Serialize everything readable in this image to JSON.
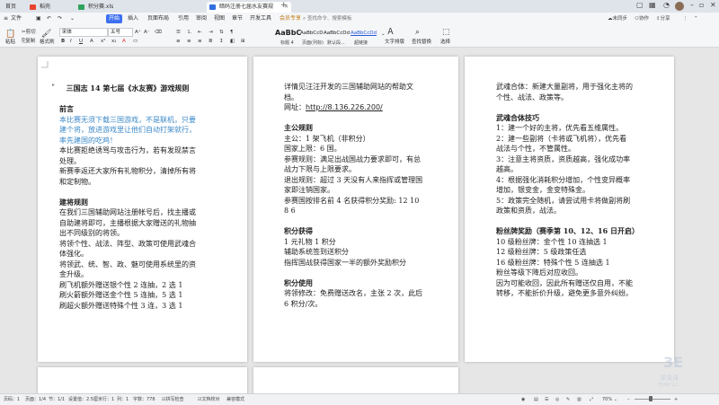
{
  "tabs": {
    "home": "首页",
    "t1": "稻壳",
    "t2": "积分赛.xls",
    "t3": "暗码注册七届水友赛规则1.0.docx"
  },
  "menu": [
    "文件",
    "开始",
    "插入",
    "页面布局",
    "引用",
    "审阅",
    "视图",
    "章节",
    "开发工具",
    "会员专享"
  ],
  "search_placeholder": "查找命令、搜索模板",
  "menu_right": {
    "unsync": "未同步",
    "cooperate": "协作",
    "share": "分享"
  },
  "ribbon": {
    "paste": "粘贴",
    "cut": "剪切",
    "copy": "复制",
    "format_painter": "格式刷",
    "font": "宋体",
    "font_size": "五号",
    "styles": [
      {
        "preview": "AaBbC",
        "label": "标题 4"
      },
      {
        "preview": "AaBbCcD",
        "label": "页面(列标)"
      },
      {
        "preview": "AaBbCcDd",
        "label": "默认段..."
      },
      {
        "preview": "AaBbCcDd",
        "label": "超链接"
      }
    ],
    "text_tools": "文字排版",
    "find_replace": "查找替换",
    "select": "选择"
  },
  "page1": {
    "title": "三国志 14 第七届《水友赛》游戏规则",
    "h_preface": "前言",
    "preface_blue": [
      "本比赛无须下载三国游戏，不是联机，只要",
      "建个将，放进游戏里让他们自动打架就行，",
      "率先建国的吃鸡！"
    ],
    "preface": [
      "本比赛拒绝诱骂与攻击行为，若有发现禁言",
      "处理。",
      "新赛季返还大家所有礼物积分，清掉所有将",
      "和定制物。"
    ],
    "h_rules": "建将规则",
    "rules": [
      "在我们三国辅助网站注册帐号后，找主播或",
      "自助建将即可，主播根据大家赠送的礼物抽",
      "出不同级别的将领。",
      "将领个性、战法、阵型、政策可使用武魂合",
      "体强化。",
      "将领武、统、智、政、魅可使用系统里的资",
      "金升级。",
      "刷飞机额外赠送银个性 2 连抽，2 选 1",
      "刷火箭额外赠送金个性 5 连抽，5 选 1",
      "刷超火额外赠送特殊个性 3 连，3 选 1"
    ]
  },
  "page2": {
    "intro": [
      "详情见汪汪开发的三国辅助网站的帮助文",
      "档。"
    ],
    "url_label": "网址：",
    "url": "http://8.136.226.200/",
    "h_main": "主公规则",
    "main": [
      "主公：1 架飞机（非积分）",
      "国家上限：6 国。",
      "参赛规则：满足出战国战力要求即可，有总",
      "战力下限与上限要求。",
      "退出规则：超过 3 天没有人来指挥或管理国",
      "家即注销国家。",
      "参赛国按排名前 4 名获得积分奖励: 12    10",
      "8    6"
    ],
    "h_points": "积分获得",
    "points": [
      "1 元礼物 1 积分",
      "辅助系统签到送积分",
      "指挥国战获得国家一半的额外奖励积分"
    ],
    "h_use": "积分使用",
    "use": [
      "将领修改：免费赠送改名，主张 2 次，此后",
      "6 积分/次。"
    ]
  },
  "page3": {
    "intro": [
      "武魂合体：新建大量副将，用于强化主将的",
      "个性、战法、政策等。"
    ],
    "h_tips": "武魂合体技巧",
    "tips": [
      "1：建一个好的主将，优先看五维属性。",
      "2：建一些副将（卡将或飞机将），优先看",
      "战法与个性，不管属性。",
      "3：注意主将资质，资质越高，强化成功率",
      "越高。",
      "4：根据强化消耗积分增加，个性变异概率",
      "增加，银变金，金变特殊金。",
      "5：政策完全随机，请尝试用卡将做副将刷",
      "政策和资质，战法。"
    ],
    "h_fans": "粉丝牌奖励（赛季第 10、12、16 日开启）",
    "fans": [
      "10 级粉丝牌：金个性 10 连抽选 1",
      "12 级粉丝牌：5 级政策任选",
      "16 级粉丝牌：特殊个性 5 连抽选 1",
      "粉丝等级下降后对应收回。",
      "因为可能收回，因此所有赠送仅自用，不能",
      "转移，不能折价升级，避免更多意外纠纷。"
    ]
  },
  "status": {
    "page": "页码：1",
    "pages": "页面：1/4",
    "section": "节：1/1",
    "setting": "设置值：2.5厘米",
    "row": "行：1",
    "col": "列：1",
    "words": "字数：778",
    "spell": "拼写检查",
    "doc_check": "文档校对",
    "compat": "兼容模式",
    "zoom": "70%"
  },
  "watermark": {
    "big": "3E",
    "mid": "课课课",
    "small": "EDWC2/1"
  }
}
